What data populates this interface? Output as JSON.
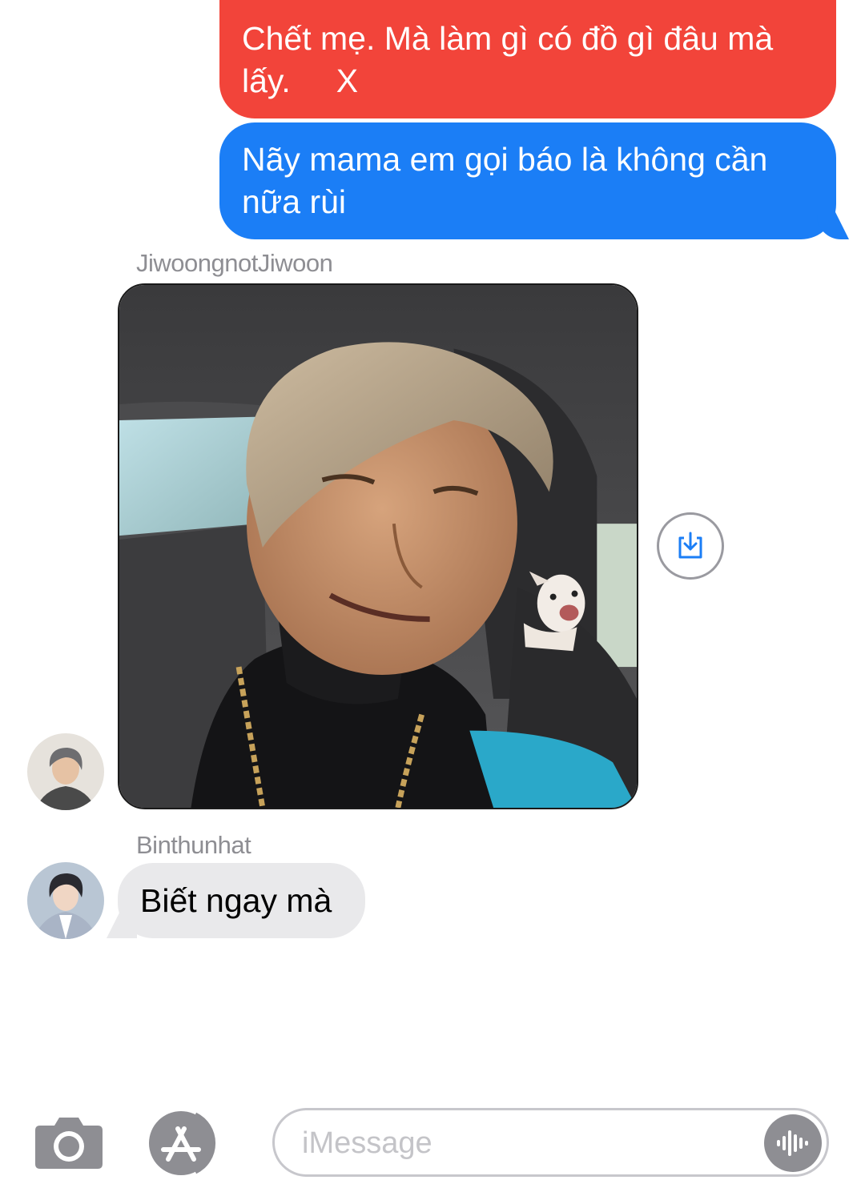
{
  "conversation": {
    "messages_out": [
      {
        "text": "Chết mẹ. Mà làm gì có đồ gì đâu mà lấy.     X",
        "color": "#f2443a"
      },
      {
        "text": "Nãy mama em gọi báo là không cần nữa rùi",
        "color": "#1b7ef6"
      }
    ],
    "image_message": {
      "sender": "JiwoongnotJiwoon",
      "download_icon": "download-icon"
    },
    "text_message_in": {
      "sender": "Binthunhat",
      "text": "Biết ngay mà"
    }
  },
  "input_bar": {
    "camera_icon": "camera-icon",
    "appstore_icon": "appstore-icon",
    "placeholder": "iMessage",
    "audio_icon": "audio-waveform-icon"
  },
  "colors": {
    "accent_blue": "#1b7ef6",
    "alert_red": "#f2443a",
    "incoming_bubble": "#e9e9eb",
    "secondary_text": "#8e8e93"
  }
}
